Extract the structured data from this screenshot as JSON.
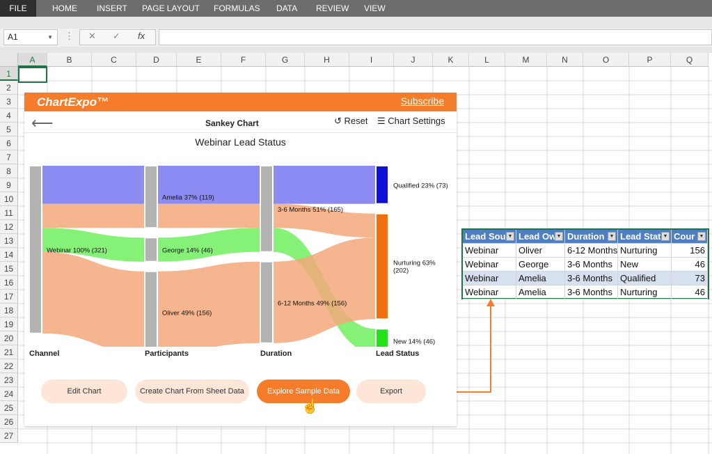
{
  "ribbon": {
    "tabs": [
      "FILE",
      "HOME",
      "INSERT",
      "PAGE LAYOUT",
      "FORMULAS",
      "DATA",
      "REVIEW",
      "VIEW"
    ]
  },
  "formula_bar": {
    "name_box": "A1",
    "cancel_icon": "✕",
    "enter_icon": "✓",
    "fx_label": "fx"
  },
  "sheet": {
    "columns": [
      "A",
      "B",
      "C",
      "D",
      "E",
      "F",
      "G",
      "H",
      "I",
      "J",
      "K",
      "L",
      "M",
      "N",
      "O",
      "P",
      "Q"
    ],
    "rows": [
      "1",
      "2",
      "3",
      "4",
      "5",
      "6",
      "7",
      "8",
      "9",
      "10",
      "11",
      "12",
      "13",
      "14",
      "15",
      "16",
      "17",
      "18",
      "19",
      "20",
      "21",
      "22",
      "23",
      "24",
      "25",
      "26",
      "27"
    ]
  },
  "panel": {
    "logo": "ChartExpo™",
    "subscribe": "Subscribe",
    "title": "Sankey Chart",
    "reset": "Reset",
    "settings": "Chart Settings",
    "chart_title": "Webinar Lead Status",
    "buttons": [
      "Edit Chart",
      "Create Chart From Sheet Data",
      "Explore Sample Data",
      "Export"
    ]
  },
  "chart_data": {
    "type": "sankey",
    "title": "Webinar Lead Status",
    "levels": [
      "Channel",
      "Participants",
      "Duration",
      "Lead Status"
    ],
    "nodes": [
      {
        "id": "webinar",
        "label": "Webinar 100% (321)",
        "value": 321,
        "color": "#b3b3b3"
      },
      {
        "id": "amelia",
        "label": "Amelia 37% (119)",
        "value": 119,
        "color": "#b3b3b3"
      },
      {
        "id": "george",
        "label": "George 14% (46)",
        "value": 46,
        "color": "#b3b3b3"
      },
      {
        "id": "oliver",
        "label": "Oliver 49% (156)",
        "value": 156,
        "color": "#b3b3b3"
      },
      {
        "id": "d36",
        "label": "3-6 Months 51% (165)",
        "value": 165,
        "color": "#b3b3b3"
      },
      {
        "id": "d612",
        "label": "6-12 Months 49% (156)",
        "value": 156,
        "color": "#b3b3b3"
      },
      {
        "id": "qualified",
        "label": "Qualified 23% (73)",
        "value": 73,
        "color": "#1010d8"
      },
      {
        "id": "nurturing",
        "label": "Nurturing 63% (202)",
        "value": 202,
        "color": "#f07010"
      },
      {
        "id": "new",
        "label": "New 14% (46)",
        "value": 46,
        "color": "#22e31a"
      }
    ],
    "links": [
      {
        "source": "webinar",
        "target": "amelia",
        "value": 73,
        "status": "qualified"
      },
      {
        "source": "webinar",
        "target": "amelia",
        "value": 46,
        "status": "nurturing"
      },
      {
        "source": "webinar",
        "target": "george",
        "value": 46,
        "status": "new"
      },
      {
        "source": "webinar",
        "target": "oliver",
        "value": 156,
        "status": "nurturing"
      },
      {
        "source": "amelia",
        "target": "d36",
        "value": 73,
        "status": "qualified"
      },
      {
        "source": "amelia",
        "target": "d36",
        "value": 46,
        "status": "nurturing"
      },
      {
        "source": "george",
        "target": "d36",
        "value": 46,
        "status": "new"
      },
      {
        "source": "oliver",
        "target": "d612",
        "value": 156,
        "status": "nurturing"
      },
      {
        "source": "d36",
        "target": "qualified",
        "value": 73,
        "status": "qualified"
      },
      {
        "source": "d36",
        "target": "nurturing",
        "value": 46,
        "status": "nurturing"
      },
      {
        "source": "d36",
        "target": "new",
        "value": 46,
        "status": "new"
      },
      {
        "source": "d612",
        "target": "nurturing",
        "value": 156,
        "status": "nurturing"
      }
    ],
    "link_colors": {
      "qualified": "#7777ee",
      "nurturing": "#f3a87a",
      "new": "#66ee55"
    }
  },
  "table": {
    "headers": [
      "Lead Sour",
      "Lead Ow",
      "Duration",
      "Lead Stat",
      "Cour"
    ],
    "rows": [
      [
        "Webinar",
        "Oliver",
        "6-12 Months",
        "Nurturing",
        "156"
      ],
      [
        "Webinar",
        "George",
        "3-6 Months",
        "New",
        "46"
      ],
      [
        "Webinar",
        "Amelia",
        "3-6 Months",
        "Qualified",
        "73"
      ],
      [
        "Webinar",
        "Amelia",
        "3-6 Months",
        "Nurturing",
        "46"
      ]
    ]
  }
}
